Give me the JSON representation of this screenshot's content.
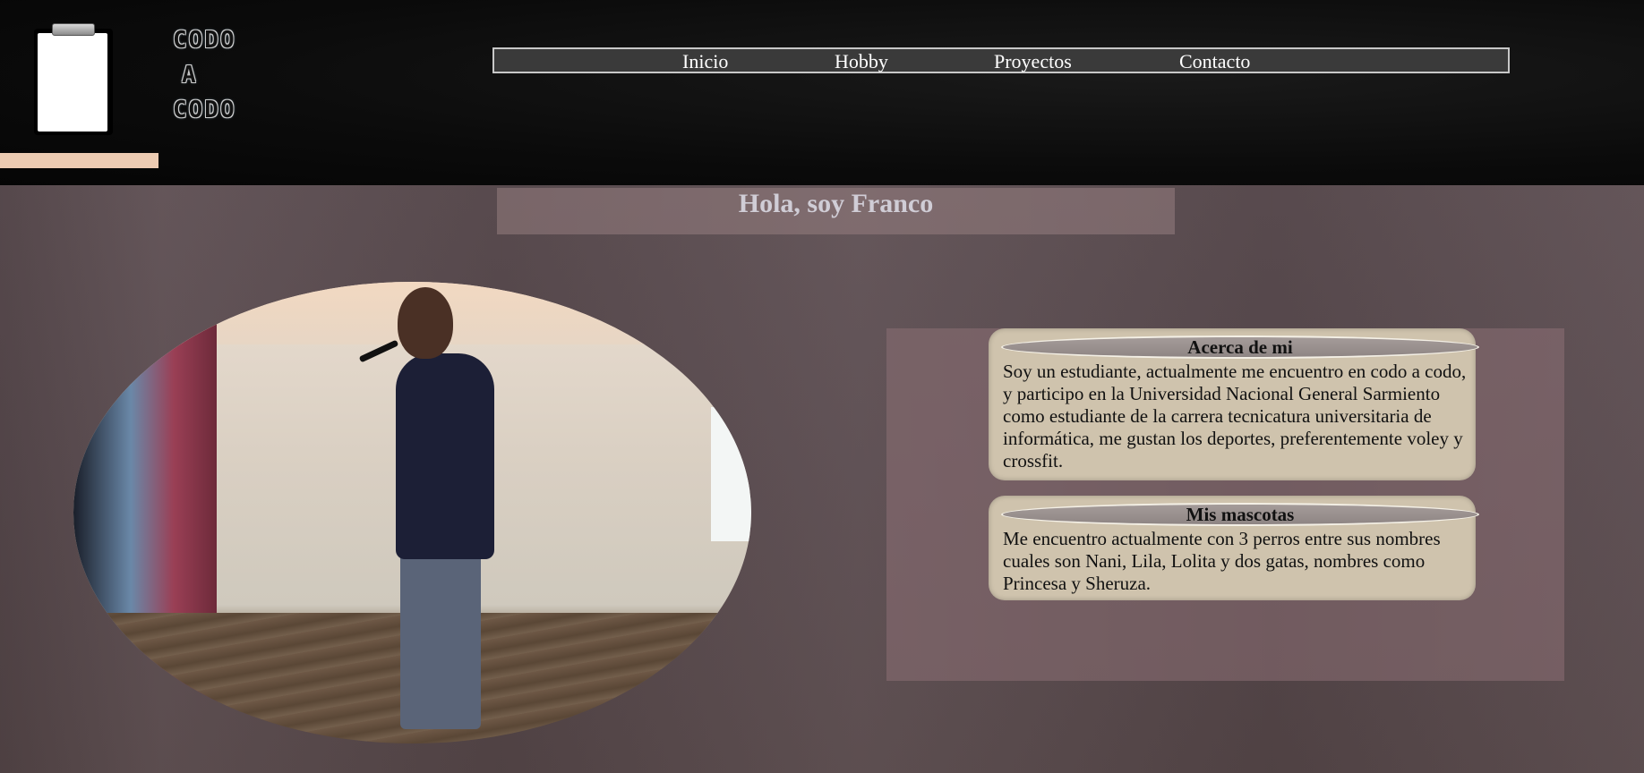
{
  "logo": {
    "lines": [
      "CODO",
      "A",
      "CODO"
    ]
  },
  "nav": {
    "items": [
      "Inicio",
      "Hobby",
      "Proyectos",
      "Contacto"
    ]
  },
  "main": {
    "greeting": "Hola, soy Franco"
  },
  "cards": [
    {
      "title": "Acerca de mi",
      "body": "Soy un estudiante, actualmente me encuentro en codo a codo, y participo en la Universidad Nacional General Sarmiento como estudiante de la carrera tecnicatura universitaria de informática, me gustan los deportes, preferentemente voley y crossfit."
    },
    {
      "title": "Mis mascotas",
      "body": "Me encuentro actualmente con 3 perros entre sus nombres cuales son Nani, Lila, Lolita y dos gatas, nombres como Princesa y Sheruza."
    }
  ],
  "colors": {
    "header_bg": "#0b0b0b",
    "accent_peach": "#eccbb2",
    "card_bg": "#cfc3ad",
    "panel_bg": "#8c7074",
    "greeting_text": "#d0cdd6"
  }
}
